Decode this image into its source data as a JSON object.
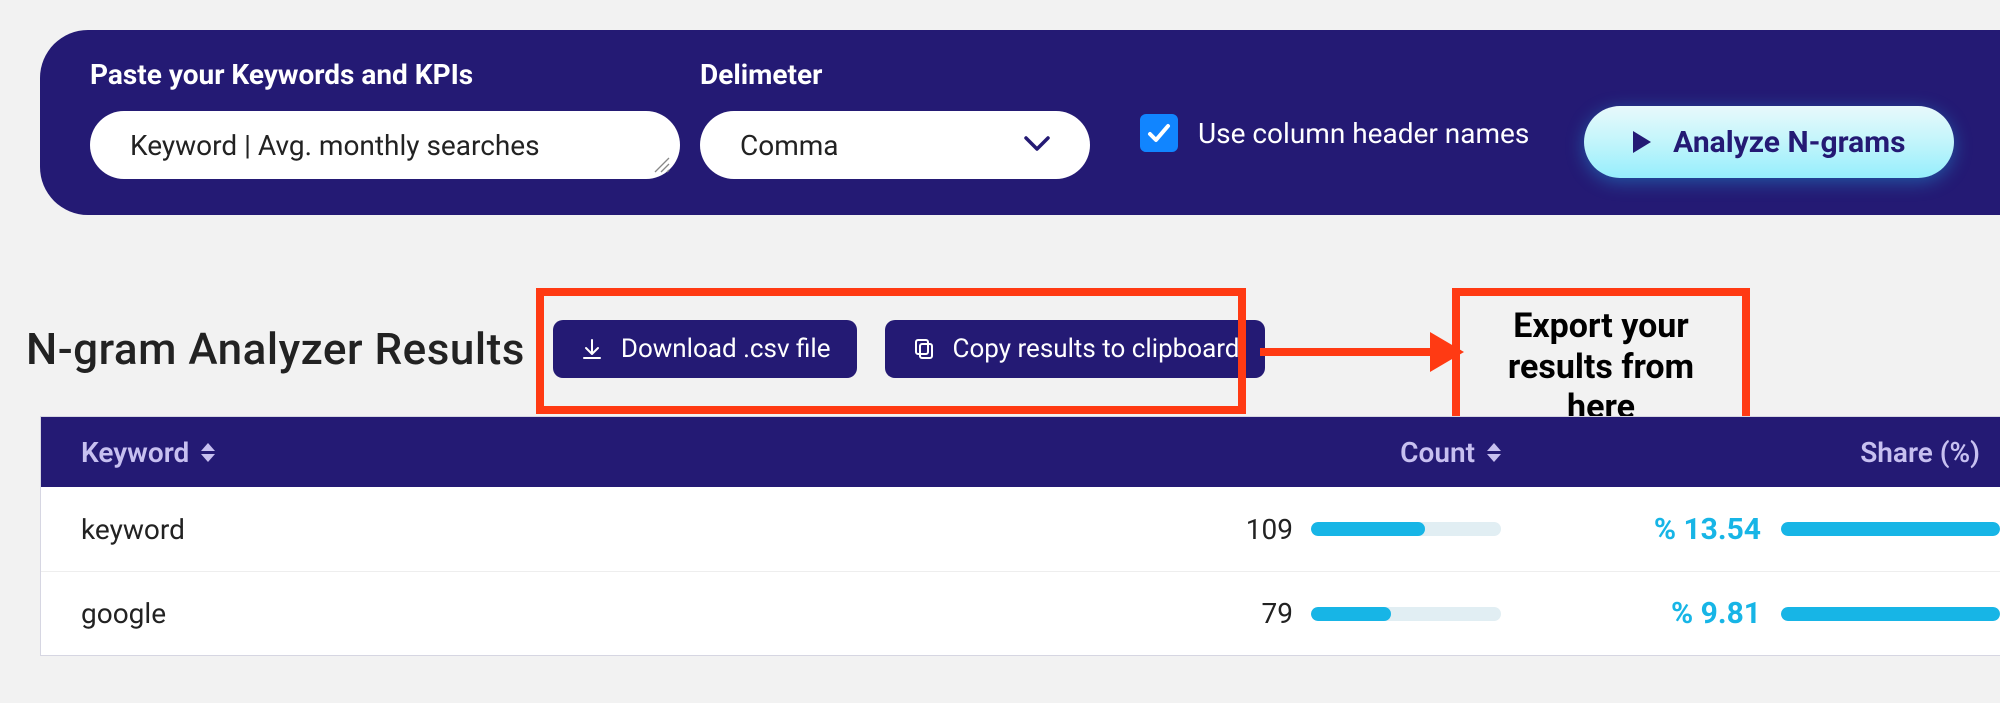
{
  "panel": {
    "keywords_label": "Paste your Keywords and KPIs",
    "keywords_value": "Keyword  |  Avg. monthly searches",
    "delimeter_label": "Delimeter",
    "delimeter_value": "Comma",
    "checkbox_checked": true,
    "checkbox_label": "Use column header names",
    "analyze_label": "Analyze N-grams"
  },
  "results": {
    "title": "N-gram Analyzer Results",
    "download_label": "Download .csv file",
    "copy_label": "Copy results to clipboard"
  },
  "annotation": {
    "text": "Export your results from here"
  },
  "table": {
    "headers": {
      "keyword": "Keyword",
      "count": "Count",
      "share": "Share (%)"
    },
    "rows": [
      {
        "keyword": "keyword",
        "count": "109",
        "count_bar_pct": 60,
        "share": "% 13.54",
        "share_bar_pct": 100
      },
      {
        "keyword": "google",
        "count": "79",
        "count_bar_pct": 42,
        "share": "% 9.81",
        "share_bar_pct": 100
      }
    ]
  }
}
